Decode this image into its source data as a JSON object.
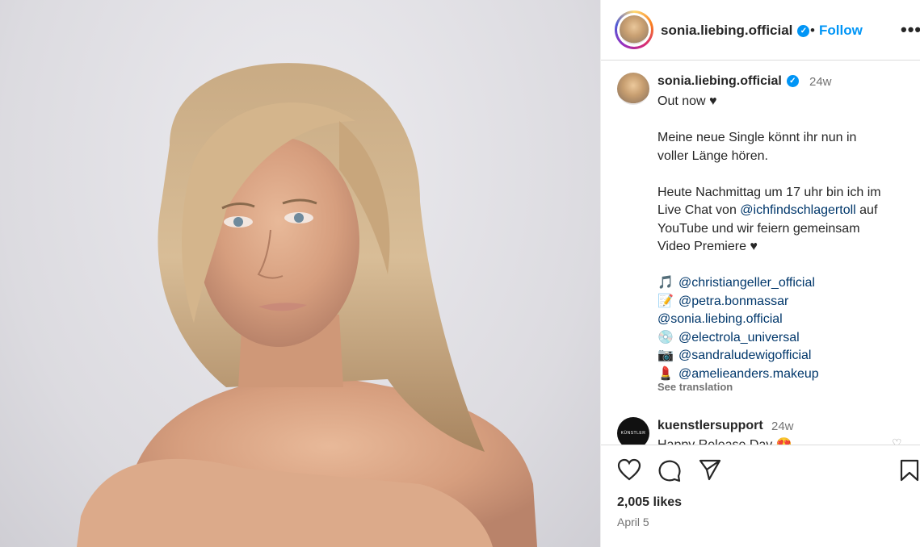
{
  "post_image": {
    "alt": ""
  },
  "header": {
    "username": "sonia.liebing.official",
    "verified": true,
    "separator": "•",
    "follow_label": "Follow",
    "more_label": "•••"
  },
  "caption": {
    "username": "sonia.liebing.official",
    "time": "24w",
    "lines": [
      "Out now ♥",
      "",
      "Meine neue Single könnt ihr nun in",
      "voller Länge hören.",
      "",
      "Heute Nachmittag um 17 uhr bin ich im",
      "Live Chat von ",
      "YouTube und wir feiern gemeinsam",
      "Video Premiere ♥",
      ""
    ],
    "mention_chat": "@ichfindschlagertoll",
    "mention_chat_suffix": " auf",
    "credits": [
      {
        "emoji": "🎵",
        "handle": "@christiangeller_official"
      },
      {
        "emoji": "📝",
        "handle": "@petra.bonmassar"
      },
      {
        "emoji": "",
        "handle": "@sonia.liebing.official"
      },
      {
        "emoji": "💿",
        "handle": "@electrola_universal"
      },
      {
        "emoji": "📷",
        "handle": "@sandraludewigofficial"
      },
      {
        "emoji": "💄",
        "handle": "@amelieanders.makeup"
      }
    ],
    "see_translation": "See translation"
  },
  "comment2": {
    "avatar_text": "KÜNSTLER SUPPORT",
    "username": "kuenstlersupport",
    "time": "24w",
    "text": "Happy Release Day 😍"
  },
  "actions": {
    "likes": "2,005 likes",
    "date": "April 5"
  },
  "colors": {
    "link": "#00376b",
    "accent": "#0095f6",
    "muted": "#737373"
  }
}
